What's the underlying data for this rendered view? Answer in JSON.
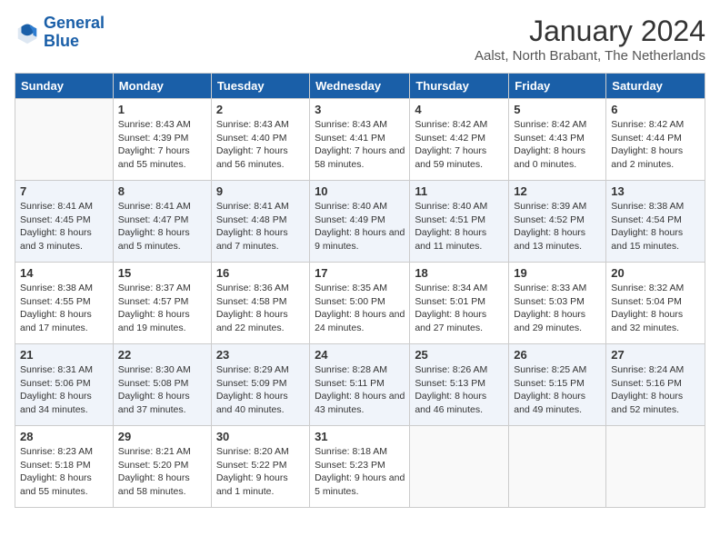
{
  "logo": {
    "line1": "General",
    "line2": "Blue"
  },
  "header": {
    "month": "January 2024",
    "location": "Aalst, North Brabant, The Netherlands"
  },
  "weekdays": [
    "Sunday",
    "Monday",
    "Tuesday",
    "Wednesday",
    "Thursday",
    "Friday",
    "Saturday"
  ],
  "weeks": [
    [
      {
        "day": "",
        "sunrise": "",
        "sunset": "",
        "daylight": ""
      },
      {
        "day": "1",
        "sunrise": "Sunrise: 8:43 AM",
        "sunset": "Sunset: 4:39 PM",
        "daylight": "Daylight: 7 hours and 55 minutes."
      },
      {
        "day": "2",
        "sunrise": "Sunrise: 8:43 AM",
        "sunset": "Sunset: 4:40 PM",
        "daylight": "Daylight: 7 hours and 56 minutes."
      },
      {
        "day": "3",
        "sunrise": "Sunrise: 8:43 AM",
        "sunset": "Sunset: 4:41 PM",
        "daylight": "Daylight: 7 hours and 58 minutes."
      },
      {
        "day": "4",
        "sunrise": "Sunrise: 8:42 AM",
        "sunset": "Sunset: 4:42 PM",
        "daylight": "Daylight: 7 hours and 59 minutes."
      },
      {
        "day": "5",
        "sunrise": "Sunrise: 8:42 AM",
        "sunset": "Sunset: 4:43 PM",
        "daylight": "Daylight: 8 hours and 0 minutes."
      },
      {
        "day": "6",
        "sunrise": "Sunrise: 8:42 AM",
        "sunset": "Sunset: 4:44 PM",
        "daylight": "Daylight: 8 hours and 2 minutes."
      }
    ],
    [
      {
        "day": "7",
        "sunrise": "Sunrise: 8:41 AM",
        "sunset": "Sunset: 4:45 PM",
        "daylight": "Daylight: 8 hours and 3 minutes."
      },
      {
        "day": "8",
        "sunrise": "Sunrise: 8:41 AM",
        "sunset": "Sunset: 4:47 PM",
        "daylight": "Daylight: 8 hours and 5 minutes."
      },
      {
        "day": "9",
        "sunrise": "Sunrise: 8:41 AM",
        "sunset": "Sunset: 4:48 PM",
        "daylight": "Daylight: 8 hours and 7 minutes."
      },
      {
        "day": "10",
        "sunrise": "Sunrise: 8:40 AM",
        "sunset": "Sunset: 4:49 PM",
        "daylight": "Daylight: 8 hours and 9 minutes."
      },
      {
        "day": "11",
        "sunrise": "Sunrise: 8:40 AM",
        "sunset": "Sunset: 4:51 PM",
        "daylight": "Daylight: 8 hours and 11 minutes."
      },
      {
        "day": "12",
        "sunrise": "Sunrise: 8:39 AM",
        "sunset": "Sunset: 4:52 PM",
        "daylight": "Daylight: 8 hours and 13 minutes."
      },
      {
        "day": "13",
        "sunrise": "Sunrise: 8:38 AM",
        "sunset": "Sunset: 4:54 PM",
        "daylight": "Daylight: 8 hours and 15 minutes."
      }
    ],
    [
      {
        "day": "14",
        "sunrise": "Sunrise: 8:38 AM",
        "sunset": "Sunset: 4:55 PM",
        "daylight": "Daylight: 8 hours and 17 minutes."
      },
      {
        "day": "15",
        "sunrise": "Sunrise: 8:37 AM",
        "sunset": "Sunset: 4:57 PM",
        "daylight": "Daylight: 8 hours and 19 minutes."
      },
      {
        "day": "16",
        "sunrise": "Sunrise: 8:36 AM",
        "sunset": "Sunset: 4:58 PM",
        "daylight": "Daylight: 8 hours and 22 minutes."
      },
      {
        "day": "17",
        "sunrise": "Sunrise: 8:35 AM",
        "sunset": "Sunset: 5:00 PM",
        "daylight": "Daylight: 8 hours and 24 minutes."
      },
      {
        "day": "18",
        "sunrise": "Sunrise: 8:34 AM",
        "sunset": "Sunset: 5:01 PM",
        "daylight": "Daylight: 8 hours and 27 minutes."
      },
      {
        "day": "19",
        "sunrise": "Sunrise: 8:33 AM",
        "sunset": "Sunset: 5:03 PM",
        "daylight": "Daylight: 8 hours and 29 minutes."
      },
      {
        "day": "20",
        "sunrise": "Sunrise: 8:32 AM",
        "sunset": "Sunset: 5:04 PM",
        "daylight": "Daylight: 8 hours and 32 minutes."
      }
    ],
    [
      {
        "day": "21",
        "sunrise": "Sunrise: 8:31 AM",
        "sunset": "Sunset: 5:06 PM",
        "daylight": "Daylight: 8 hours and 34 minutes."
      },
      {
        "day": "22",
        "sunrise": "Sunrise: 8:30 AM",
        "sunset": "Sunset: 5:08 PM",
        "daylight": "Daylight: 8 hours and 37 minutes."
      },
      {
        "day": "23",
        "sunrise": "Sunrise: 8:29 AM",
        "sunset": "Sunset: 5:09 PM",
        "daylight": "Daylight: 8 hours and 40 minutes."
      },
      {
        "day": "24",
        "sunrise": "Sunrise: 8:28 AM",
        "sunset": "Sunset: 5:11 PM",
        "daylight": "Daylight: 8 hours and 43 minutes."
      },
      {
        "day": "25",
        "sunrise": "Sunrise: 8:26 AM",
        "sunset": "Sunset: 5:13 PM",
        "daylight": "Daylight: 8 hours and 46 minutes."
      },
      {
        "day": "26",
        "sunrise": "Sunrise: 8:25 AM",
        "sunset": "Sunset: 5:15 PM",
        "daylight": "Daylight: 8 hours and 49 minutes."
      },
      {
        "day": "27",
        "sunrise": "Sunrise: 8:24 AM",
        "sunset": "Sunset: 5:16 PM",
        "daylight": "Daylight: 8 hours and 52 minutes."
      }
    ],
    [
      {
        "day": "28",
        "sunrise": "Sunrise: 8:23 AM",
        "sunset": "Sunset: 5:18 PM",
        "daylight": "Daylight: 8 hours and 55 minutes."
      },
      {
        "day": "29",
        "sunrise": "Sunrise: 8:21 AM",
        "sunset": "Sunset: 5:20 PM",
        "daylight": "Daylight: 8 hours and 58 minutes."
      },
      {
        "day": "30",
        "sunrise": "Sunrise: 8:20 AM",
        "sunset": "Sunset: 5:22 PM",
        "daylight": "Daylight: 9 hours and 1 minute."
      },
      {
        "day": "31",
        "sunrise": "Sunrise: 8:18 AM",
        "sunset": "Sunset: 5:23 PM",
        "daylight": "Daylight: 9 hours and 5 minutes."
      },
      {
        "day": "",
        "sunrise": "",
        "sunset": "",
        "daylight": ""
      },
      {
        "day": "",
        "sunrise": "",
        "sunset": "",
        "daylight": ""
      },
      {
        "day": "",
        "sunrise": "",
        "sunset": "",
        "daylight": ""
      }
    ]
  ]
}
